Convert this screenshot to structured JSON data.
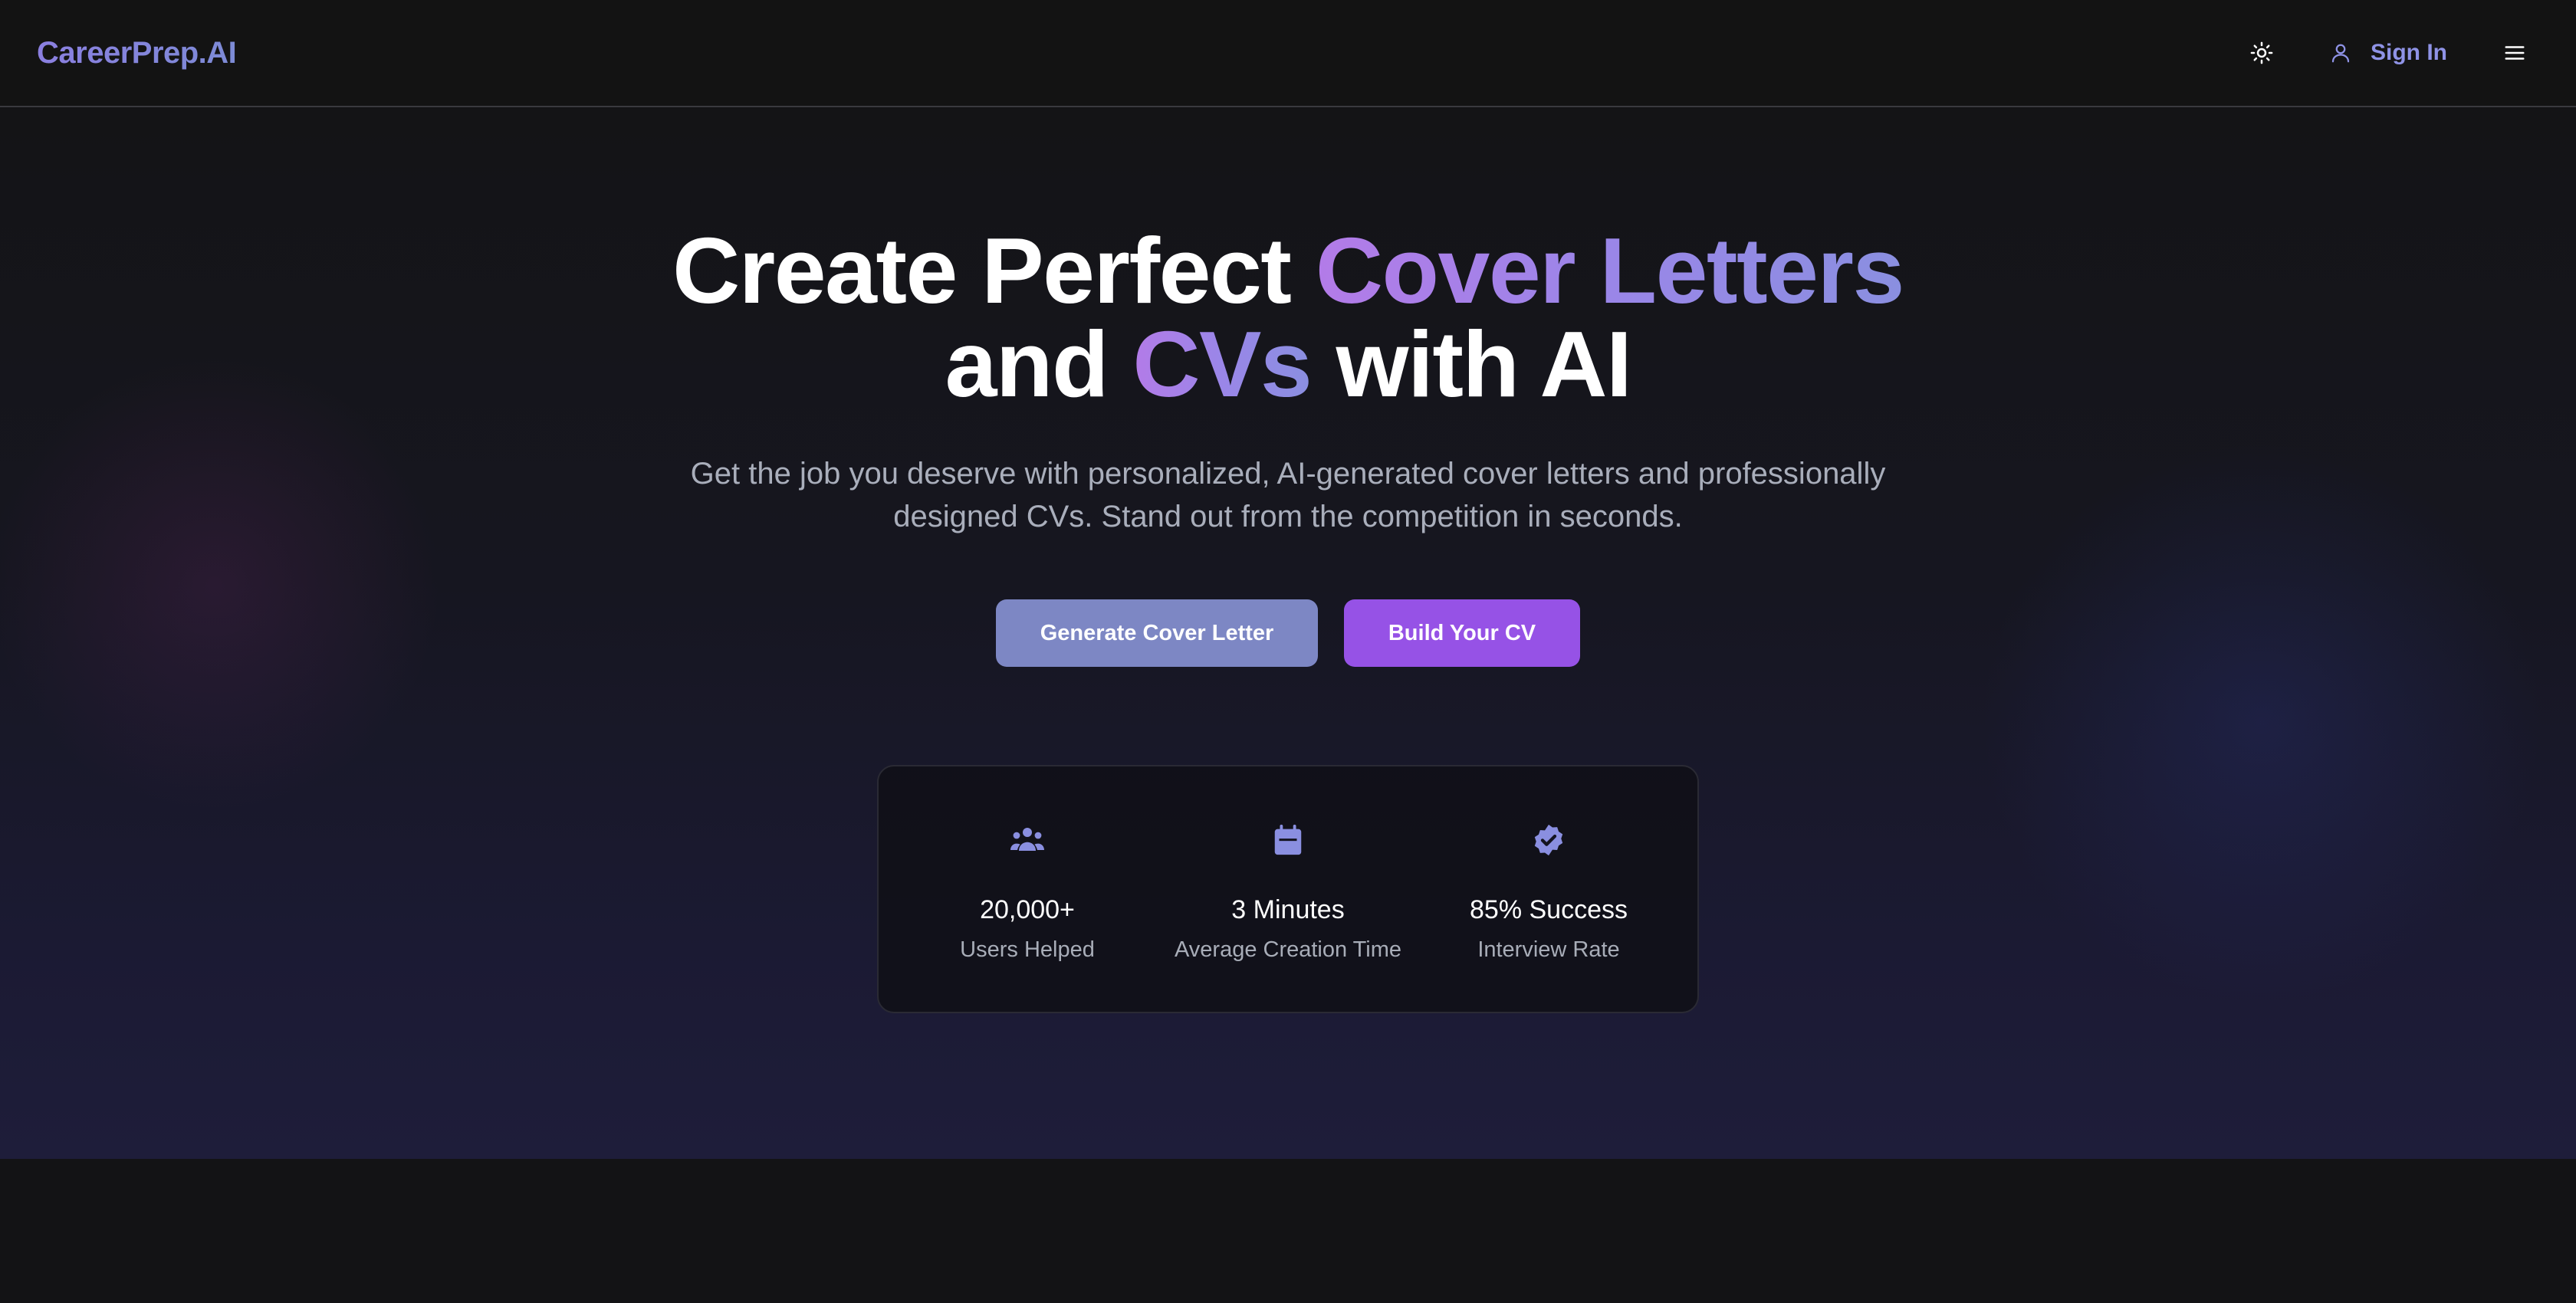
{
  "nav": {
    "brand": "CareerPrep.AI",
    "theme_icon": "sun-icon",
    "signin_icon": "user-icon",
    "signin_label": "Sign In",
    "menu_icon": "hamburger-menu-icon"
  },
  "hero": {
    "headline_line1_plain": "Create Perfect ",
    "headline_line1_accent": "Cover Letters",
    "headline_line2_plain_a": "and ",
    "headline_line2_accent": "CVs",
    "headline_line2_plain_b": " with AI",
    "subtitle": "Get the job you deserve with personalized, AI-generated cover letters and professionally designed CVs. Stand out from the competition in seconds.",
    "primary_button": "Generate Cover Letter",
    "secondary_button": "Build Your CV"
  },
  "stats": [
    {
      "icon": "users-group-icon",
      "value": "20,000+",
      "label": "Users Helped"
    },
    {
      "icon": "calendar-icon",
      "value": "3 Minutes",
      "label": "Average Creation Time"
    },
    {
      "icon": "verified-badge-icon",
      "value": "85% Success",
      "label": "Interview Rate"
    }
  ],
  "colors": {
    "background": "#131315",
    "accent_purple": "#9652e6",
    "accent_blue": "#7d87c4",
    "brand_gradient_start": "#8b7fe0",
    "text_muted": "#a9aebb"
  }
}
